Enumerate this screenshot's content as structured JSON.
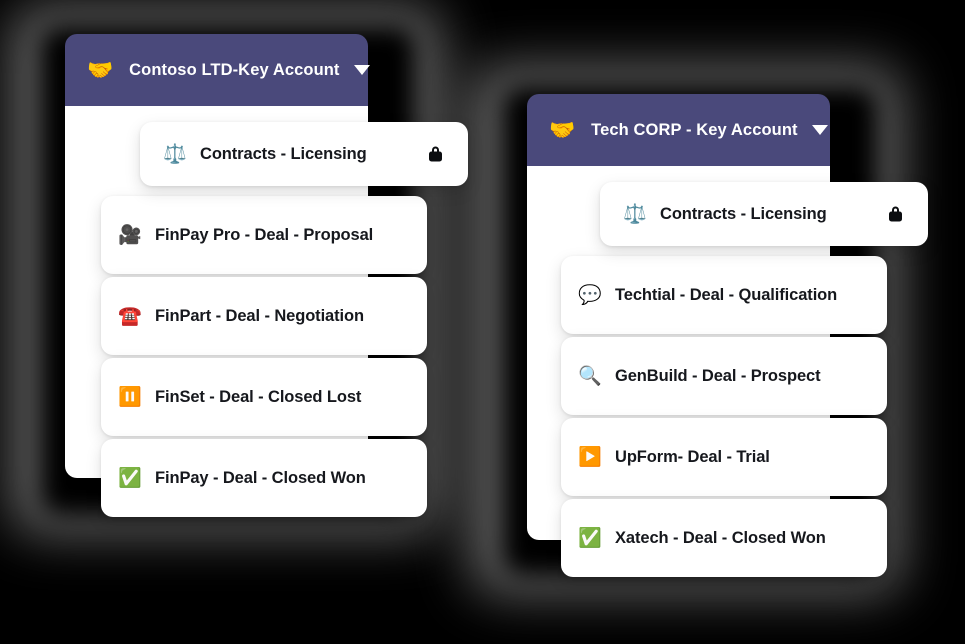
{
  "background_color": "#000000",
  "cards": [
    {
      "id": "contoso",
      "header": {
        "icon": "handshake-icon",
        "icon_glyph": "🤝",
        "title": "Contoso LTD-Key Account",
        "caret": "chevron-down-icon",
        "background_color": "#4a497b",
        "text_color": "#ffffff"
      },
      "pill": {
        "icon": "balance-scale-icon",
        "icon_glyph": "⚖️",
        "label": "Contracts - Licensing",
        "lock": "lock-icon",
        "locked": true
      },
      "rows": [
        {
          "icon": "movie-camera-icon",
          "icon_glyph": "🎥",
          "label": "FinPay Pro - Deal - Proposal"
        },
        {
          "icon": "telephone-icon",
          "icon_glyph": "☎️",
          "label": "FinPart - Deal - Negotiation"
        },
        {
          "icon": "pause-button-icon",
          "icon_glyph": "⏸️",
          "label": "FinSet - Deal - Closed Lost"
        },
        {
          "icon": "check-mark-icon",
          "icon_glyph": "✅",
          "label": "FinPay - Deal - Closed Won"
        }
      ]
    },
    {
      "id": "techcorp",
      "header": {
        "icon": "handshake-icon",
        "icon_glyph": "🤝",
        "title": "Tech CORP - Key Account",
        "caret": "chevron-down-icon",
        "background_color": "#4a497b",
        "text_color": "#ffffff"
      },
      "pill": {
        "icon": "balance-scale-icon",
        "icon_glyph": "⚖️",
        "label": "Contracts - Licensing",
        "lock": "lock-icon",
        "locked": true
      },
      "rows": [
        {
          "icon": "speech-balloon-icon",
          "icon_glyph": "💬",
          "label": "Techtial - Deal - Qualification"
        },
        {
          "icon": "magnifying-glass-icon",
          "icon_glyph": "🔍",
          "label": "GenBuild - Deal - Prospect"
        },
        {
          "icon": "play-button-icon",
          "icon_glyph": "▶️",
          "label": "UpForm- Deal - Trial"
        },
        {
          "icon": "check-mark-icon",
          "icon_glyph": "✅",
          "label": "Xatech - Deal - Closed Won"
        }
      ]
    }
  ]
}
